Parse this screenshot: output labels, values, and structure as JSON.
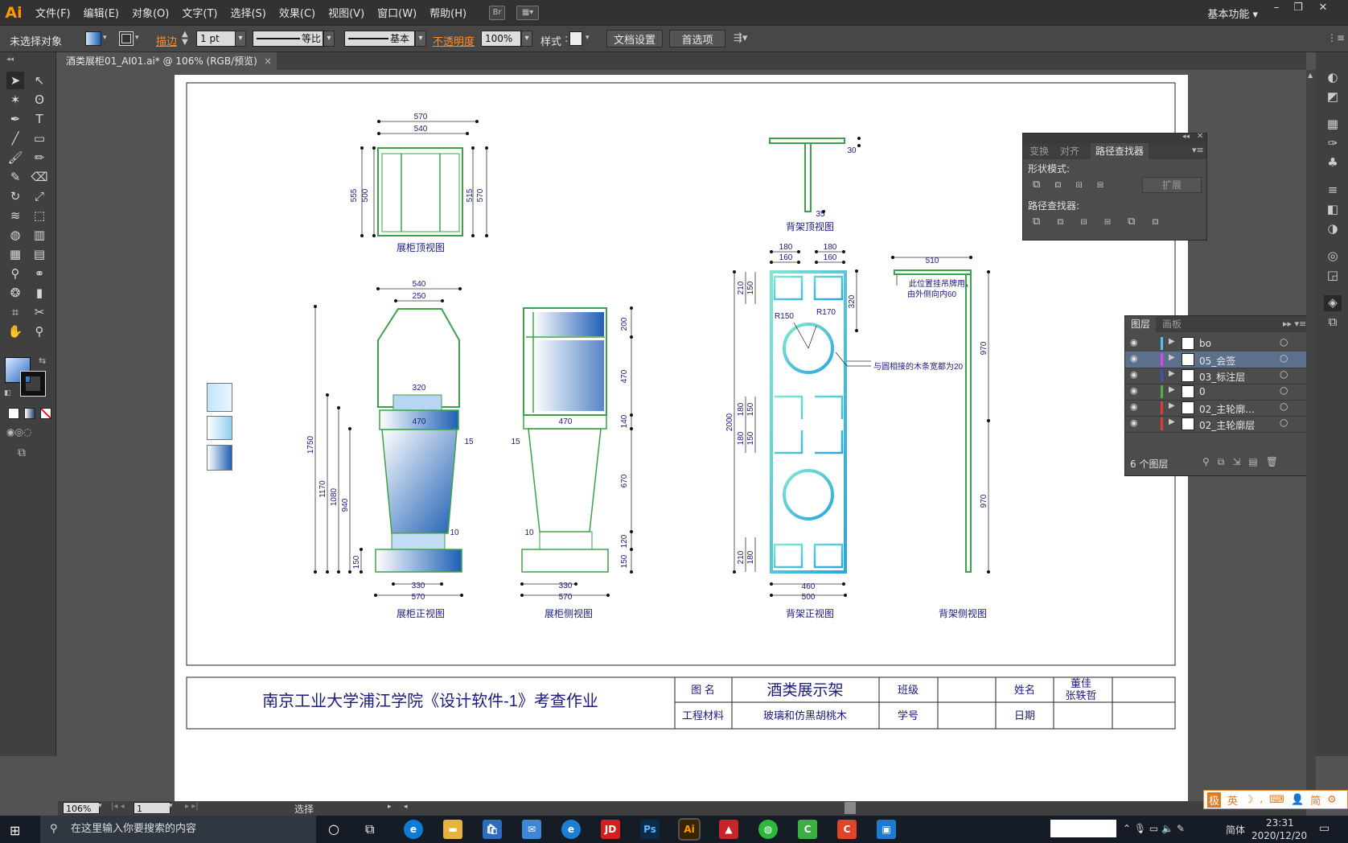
{
  "app": {
    "logo": "Ai",
    "workspace": "基本功能",
    "bridge_btn": "Br"
  },
  "menu": [
    "文件(F)",
    "编辑(E)",
    "对象(O)",
    "文字(T)",
    "选择(S)",
    "效果(C)",
    "视图(V)",
    "窗口(W)",
    "帮助(H)"
  ],
  "control_bar": {
    "selection_status": "未选择对象",
    "stroke_label": "描边",
    "stroke_weight": "1 pt",
    "profile_label": "等比",
    "brush_label": "基本",
    "opacity_label": "不透明度",
    "opacity_value": "100%",
    "style_label": "样式",
    "doc_setup_btn": "文档设置",
    "prefs_btn": "首选项"
  },
  "document_tab": {
    "title": "酒类展柜01_AI01.ai* @ 106% (RGB/预览)"
  },
  "pathfinder_panel": {
    "tabs": [
      "变换",
      "对齐",
      "路径查找器"
    ],
    "shape_modes_label": "形状模式:",
    "expand_btn": "扩展",
    "pathfinders_label": "路径查找器:"
  },
  "layers_panel": {
    "tabs": [
      "图层",
      "画板"
    ],
    "layers": [
      {
        "name": "bo",
        "color": "#4fc3f7",
        "selected": false
      },
      {
        "name": "05_会签",
        "color": "#e040fb",
        "selected": true
      },
      {
        "name": "03_标注层",
        "color": "#3f51b5",
        "selected": false
      },
      {
        "name": "0",
        "color": "#4caf50",
        "selected": false
      },
      {
        "name": "02_主轮廓...",
        "color": "#e53935",
        "selected": false
      },
      {
        "name": "02_主轮廓层",
        "color": "#e53935",
        "selected": false
      }
    ],
    "count": "6 个图层"
  },
  "drawing": {
    "views": {
      "top_view": "展柜顶视图",
      "front_view": "展柜正视图",
      "side_view": "展柜侧视图",
      "rack_top": "背架顶视图",
      "rack_front": "背架正视图",
      "rack_side": "背架侧视图"
    },
    "notes": {
      "hang": "此位置挂吊牌用，",
      "inside": "由外侧向内60",
      "joint": "与圆相接的木条宽都为20"
    },
    "dims": {
      "t570": "570",
      "t540": "540",
      "t555": "555",
      "t500": "500",
      "t515": "515",
      "t570r": "570",
      "f540": "540",
      "f250": "250",
      "f320": "320",
      "f470": "470",
      "f15": "15",
      "f10": "10",
      "f1750": "1750",
      "f1170": "1170",
      "f1080": "1080",
      "f940": "940",
      "f150": "150",
      "f330": "330",
      "f570": "570",
      "s470": "470",
      "s15": "15",
      "s10": "10",
      "s200": "200",
      "s470v": "470",
      "s140": "140",
      "s670": "670",
      "s120": "120",
      "s150": "150",
      "s330": "330",
      "s570": "570",
      "r30": "30",
      "r35": "35",
      "b180a": "180",
      "b160a": "160",
      "b180b": "180",
      "b160b": "160",
      "b320": "320",
      "b210": "210",
      "b150": "150",
      "R150": "R150",
      "R170": "R170",
      "b2000": "2000",
      "b180c": "180",
      "b150b": "150",
      "b180d": "180",
      "b150c": "150",
      "b210b": "210",
      "b180e": "180",
      "b460": "460",
      "b500": "500",
      "s510": "510",
      "s970a": "970",
      "s970b": "970"
    }
  },
  "title_block": {
    "school": "南京工业大学浦江学院《设计软件-1》考查作业",
    "name_label": "图 名",
    "name_value": "酒类展示架",
    "class_label": "班级",
    "student_label": "姓名",
    "student_value1": "董佳",
    "student_value2": "张轶哲",
    "material_label": "工程材料",
    "material_value": "玻璃和仿黑胡桃木",
    "id_label": "学号",
    "date_label": "日期"
  },
  "status_bar": {
    "zoom": "106%",
    "artboard": "1",
    "tool": "选择"
  },
  "ime": {
    "mode": "英",
    "chars": "简"
  },
  "taskbar": {
    "search_placeholder": "在这里输入你要搜索的内容",
    "time": "23:31",
    "date": "2020/12/20",
    "lang": "简体"
  }
}
